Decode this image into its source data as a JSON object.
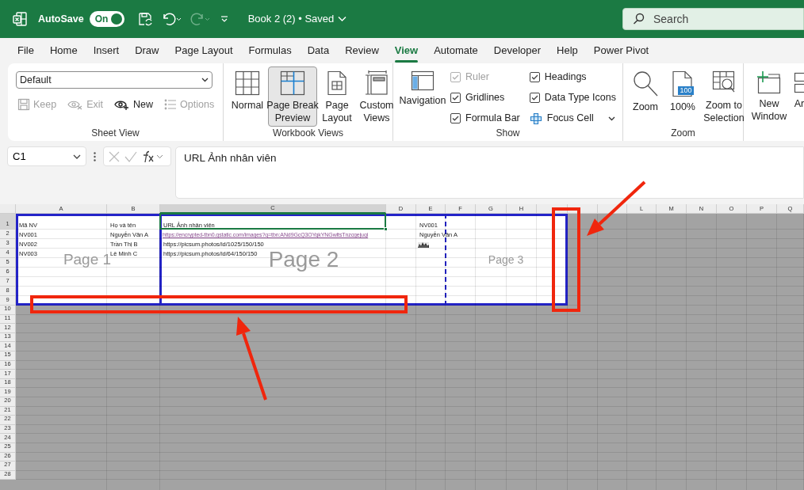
{
  "title_bar": {
    "autosave_label": "AutoSave",
    "autosave": {
      "on": true,
      "label": "On"
    },
    "document_title": "Book 2 (2) • Saved",
    "search": {
      "placeholder": "Search"
    }
  },
  "menu_tabs": [
    {
      "label": "File",
      "selected": false
    },
    {
      "label": "Home",
      "selected": false
    },
    {
      "label": "Insert",
      "selected": false
    },
    {
      "label": "Draw",
      "selected": false
    },
    {
      "label": "Page Layout",
      "selected": false
    },
    {
      "label": "Formulas",
      "selected": false
    },
    {
      "label": "Data",
      "selected": false
    },
    {
      "label": "Review",
      "selected": false
    },
    {
      "label": "View",
      "selected": true
    },
    {
      "label": "Automate",
      "selected": false
    },
    {
      "label": "Developer",
      "selected": false
    },
    {
      "label": "Help",
      "selected": false
    },
    {
      "label": "Power Pivot",
      "selected": false
    }
  ],
  "ribbon": {
    "sheet_view": {
      "label": "Sheet View",
      "dropdown": "Default",
      "buttons": [
        {
          "label": "Keep",
          "disabled": true
        },
        {
          "label": "Exit",
          "disabled": true
        },
        {
          "label": "New",
          "disabled": false
        },
        {
          "label": "Options",
          "disabled": true
        }
      ]
    },
    "workbook_views": {
      "label": "Workbook Views",
      "buttons": [
        {
          "lines": [
            "Normal"
          ],
          "selected": false
        },
        {
          "lines": [
            "Page Break",
            "Preview"
          ],
          "selected": true
        },
        {
          "lines": [
            "Page",
            "Layout"
          ],
          "selected": false
        },
        {
          "lines": [
            "Custom",
            "Views"
          ],
          "selected": false
        }
      ]
    },
    "show": {
      "label": "Show",
      "navigation": "Navigation",
      "checkboxes": [
        {
          "label": "Ruler",
          "checked": true,
          "disabled": true
        },
        {
          "label": "Gridlines",
          "checked": true,
          "disabled": false
        },
        {
          "label": "Formula Bar",
          "checked": true,
          "disabled": false
        },
        {
          "label": "Headings",
          "checked": true,
          "disabled": false
        },
        {
          "label": "Data Type Icons",
          "checked": true,
          "disabled": false
        }
      ],
      "focus_cell": "Focus Cell"
    },
    "zoom": {
      "label": "Zoom",
      "buttons": [
        {
          "lines": [
            "Zoom"
          ]
        },
        {
          "lines": [
            "100%"
          ],
          "icon_text": "100"
        },
        {
          "lines": [
            "Zoom to",
            "Selection"
          ]
        }
      ]
    },
    "window": {
      "buttons": [
        {
          "lines": [
            "New",
            "Window"
          ]
        },
        {
          "lines": [
            "Ar"
          ]
        }
      ]
    }
  },
  "formula_bar": {
    "name_box": "C1",
    "formula": "URL Ảnh nhân viên"
  },
  "sheet": {
    "columns": [
      {
        "label": "A",
        "selected": false
      },
      {
        "label": "B",
        "selected": false
      },
      {
        "label": "C",
        "selected": true
      },
      {
        "label": "D",
        "selected": false
      },
      {
        "label": "E",
        "selected": false
      },
      {
        "label": "F",
        "selected": false
      },
      {
        "label": "G",
        "selected": false
      },
      {
        "label": "H",
        "selected": false
      },
      {
        "selected": false
      },
      {
        "selected": false
      },
      {
        "selected": false
      },
      {
        "label": "L",
        "selected": false
      },
      {
        "label": "M",
        "selected": false
      },
      {
        "label": "N",
        "selected": false
      },
      {
        "label": "O",
        "selected": false
      },
      {
        "label": "P",
        "selected": false
      },
      {
        "label": "Q",
        "selected": false
      }
    ],
    "rows": [
      {
        "label": "1",
        "selected": true,
        "cells": {
          "A": {
            "kind": "text",
            "text": "Mã NV",
            "selected": false
          },
          "B": {
            "kind": "text",
            "text": "Họ và tên",
            "selected": false
          },
          "C": {
            "kind": "text",
            "text": "URL Ảnh nhân viên",
            "selected": true
          },
          "E": {
            "kind": "text",
            "text": "NV001",
            "selected": false
          }
        }
      },
      {
        "label": "2",
        "selected": false,
        "cells": {
          "A": {
            "kind": "text",
            "text": "NV001",
            "selected": false
          },
          "B": {
            "kind": "text",
            "text": "Nguyễn Văn A",
            "selected": false
          },
          "C": {
            "kind": "link",
            "text": "https://encrypted-tbn0.gstatic.com/images?q=tbn:ANd9GcQ3OYqkYNGwltsTnzcgejuqi",
            "selected": false
          },
          "E": {
            "kind": "text",
            "text": "Nguyễn Văn A",
            "selected": false
          }
        }
      },
      {
        "label": "3",
        "selected": false,
        "cells": {
          "A": {
            "kind": "text",
            "text": "NV002",
            "selected": false
          },
          "B": {
            "kind": "text",
            "text": "Trần Thị B",
            "selected": false
          },
          "C": {
            "kind": "text",
            "text": "https://picsum.photos/id/1025/150/150",
            "selected": false
          }
        }
      },
      {
        "label": "4",
        "selected": false,
        "cells": {
          "A": {
            "kind": "text",
            "text": "NV003",
            "selected": false
          },
          "B": {
            "kind": "text",
            "text": "Lê Minh C",
            "selected": false
          },
          "C": {
            "kind": "text",
            "text": "https://picsum.photos/id/64/150/150",
            "selected": false
          }
        }
      },
      {
        "label": "5",
        "selected": false
      },
      {
        "label": "6",
        "selected": false
      },
      {
        "label": "7",
        "selected": false
      },
      {
        "label": "8",
        "selected": false
      },
      {
        "label": "9",
        "selected": false
      },
      {
        "label": "10",
        "selected": false
      },
      {
        "label": "11",
        "selected": false
      },
      {
        "label": "12",
        "selected": false
      },
      {
        "label": "13",
        "selected": false
      },
      {
        "label": "14",
        "selected": false
      },
      {
        "label": "15",
        "selected": false
      },
      {
        "label": "16",
        "selected": false
      },
      {
        "label": "17",
        "selected": false
      },
      {
        "label": "18",
        "selected": false
      },
      {
        "label": "19",
        "selected": false
      },
      {
        "label": "20",
        "selected": false
      },
      {
        "label": "21",
        "selected": false
      },
      {
        "label": "22",
        "selected": false
      },
      {
        "label": "23",
        "selected": false
      },
      {
        "label": "24",
        "selected": false
      },
      {
        "label": "25",
        "selected": false
      },
      {
        "label": "26",
        "selected": false
      },
      {
        "label": "27",
        "selected": false
      },
      {
        "label": "28",
        "selected": false
      }
    ],
    "pages": [
      "Page 1",
      "Page 2",
      "Page 3"
    ]
  }
}
